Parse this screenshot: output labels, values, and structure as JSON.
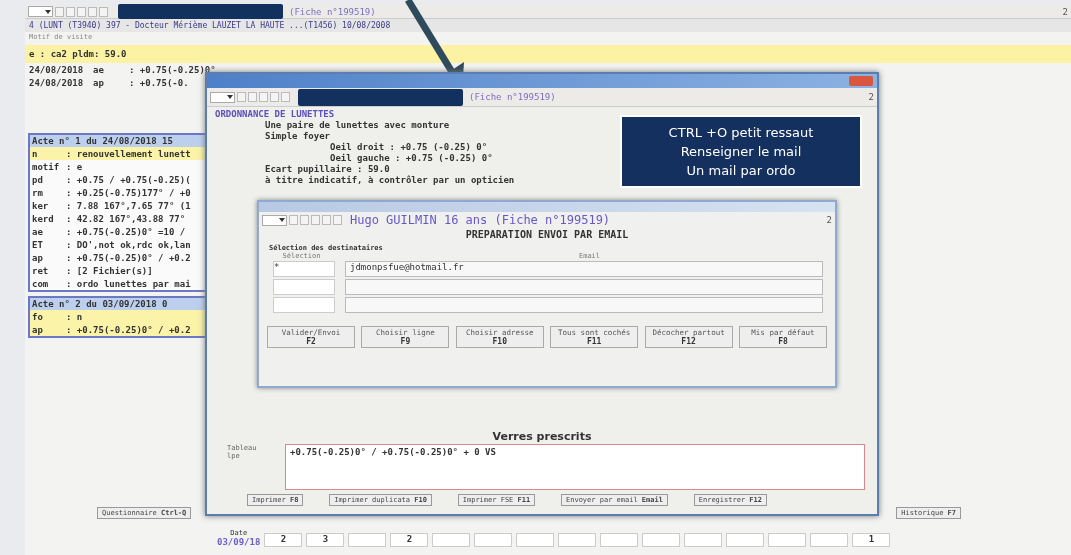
{
  "background_window": {
    "fiche": "(Fiche n°199519)",
    "corner": "2",
    "info_line": "4 (LUNT (T3940)  397 - Docteur Mérième LAUZET  LA HAUTE ...(T1456)  10/08/2008",
    "section_label": "Motif de visite",
    "motif_line": "e    : ca2 pldm: 59.0",
    "history": [
      {
        "date": "24/08/2018",
        "code": "ae",
        "value": ": +0.75(-0.25)0°"
      },
      {
        "date": "24/08/2018",
        "code": "ap",
        "value": ": +0.75(-0."
      }
    ],
    "acts": [
      {
        "header": "Acte n°  1 du 24/08/2018 15",
        "lines": [
          {
            "key": "n",
            "value": ": renouvellement lunett",
            "highlight": true
          },
          {
            "key": "motif",
            "value": ": e",
            "highlight": false
          },
          {
            "key": "pd",
            "value": ": +0.75 / +0.75(-0.25)(",
            "highlight": false
          },
          {
            "key": "rm",
            "value": ": +0.25(-0.75)177° / +0",
            "highlight": false
          },
          {
            "key": "ker",
            "value": ": 7.88 167°,7.65 77° (1",
            "highlight": false
          },
          {
            "key": "kerd",
            "value": ": 42.82 167°,43.88 77°",
            "highlight": false
          },
          {
            "key": "ae",
            "value": ": +0.75(-0.25)0° =10 /",
            "highlight": false
          },
          {
            "key": "ET",
            "value": ": DO',not ok,rdc ok,lan",
            "highlight": false
          },
          {
            "key": "ap",
            "value": ": +0.75(-0.25)0° / +0.2",
            "highlight": false
          },
          {
            "key": "ret",
            "value": ": [2 Fichier(s)]",
            "highlight": false
          },
          {
            "key": "com",
            "value": ": ordo lunettes par mai",
            "highlight": false
          }
        ]
      },
      {
        "header": "Acte n°  2 du 03/09/2018  0",
        "lines": [
          {
            "key": "fo",
            "value": ": n",
            "highlight": true
          },
          {
            "key": "ap",
            "value": ": +0.75(-0.25)0° / +0.2",
            "highlight": true
          }
        ]
      }
    ],
    "bottom_buttons": [
      {
        "label": "Questionnaire",
        "key": "Ctrl-Q"
      },
      {
        "label": "Historique",
        "key": "F7"
      }
    ],
    "date_strip": {
      "label": "Date",
      "date": "03/09/18",
      "cells": [
        "2",
        "3",
        "",
        "2",
        "",
        "",
        "",
        "",
        "",
        "",
        "",
        "",
        "",
        "",
        "1"
      ]
    }
  },
  "prescription_window": {
    "fiche": "(Fiche n°199519)",
    "corner": "2",
    "heading": "ORDONNANCE DE LUNETTES",
    "items": [
      {
        "text": "Une paire de lunettes avec monture"
      },
      {
        "text": "Simple foyer",
        "children": [
          {
            "text": "Oeil droit : +0.75 (-0.25) 0°"
          },
          {
            "text": "Oeil gauche : +0.75 (-0.25) 0°"
          }
        ]
      },
      {
        "text": "Ecart pupillaire : 59.0"
      },
      {
        "text": "à titre indicatif, à contrôler par un opticien"
      }
    ],
    "prescribed_title": "Verres prescrits",
    "field_label": "Tableau",
    "field_sublabel": "lpe",
    "field_value": "+0.75(-0.25)0° / +0.75(-0.25)0° + 0 VS",
    "buttons": [
      {
        "label": "Imprimer",
        "key": "F8"
      },
      {
        "label": "Imprimer duplicata",
        "key": "F10"
      },
      {
        "label": "Imprimer FSE",
        "key": "F11"
      },
      {
        "label": "Envoyer par email",
        "key": "Email"
      },
      {
        "label": "Enregistrer",
        "key": "F12"
      }
    ]
  },
  "email_window": {
    "title": "Hugo GUILMIN 16 ans (Fiche n°199519)",
    "corner": "2",
    "heading": "PREPARATION ENVOI PAR EMAIL",
    "section": "Sélection des destinataires",
    "columns": [
      "Sélection",
      "Email"
    ],
    "rows": [
      {
        "selection": "*",
        "email": "jdmonpsfue@hotmail.fr"
      },
      {},
      {}
    ],
    "buttons": [
      {
        "label": "Valider/Envoi",
        "key": "F2"
      },
      {
        "label": "Choisir ligne",
        "key": "F9"
      },
      {
        "label": "Choisir adresse",
        "key": "F10"
      },
      {
        "label": "Tous sont cochés",
        "key": "F11"
      },
      {
        "label": "Décocher partout",
        "key": "F12"
      },
      {
        "label": "Mis par défaut",
        "key": "F8"
      }
    ]
  },
  "callout": {
    "lines": [
      "CTRL +O  petit ressaut",
      "Renseigner le mail",
      "Un mail par ordo"
    ]
  }
}
